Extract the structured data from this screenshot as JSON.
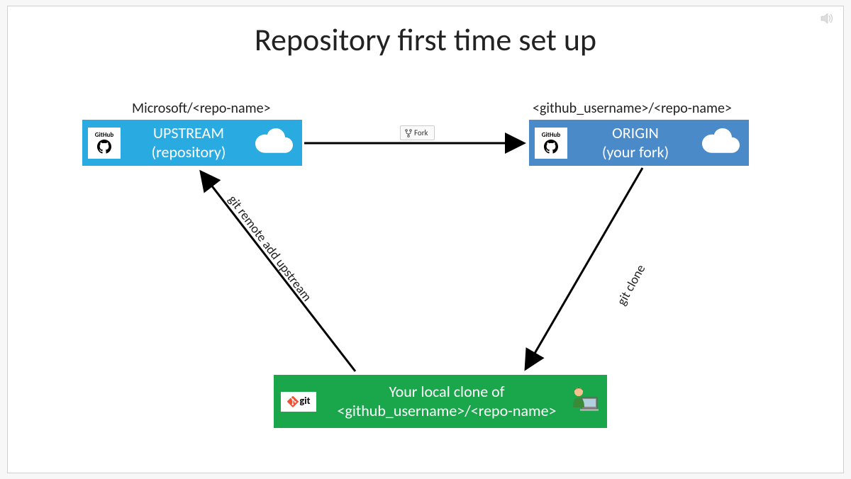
{
  "title": "Repository first time set up",
  "upstream": {
    "label": "Microsoft/<repo-name>",
    "line1": "UPSTREAM",
    "line2": "(repository)",
    "badge": "GitHub"
  },
  "origin": {
    "label": "<github_username>/<repo-name>",
    "line1": "ORIGIN",
    "line2": "(your fork)",
    "badge": "GitHub"
  },
  "local": {
    "line1": "Your local clone of",
    "line2": "<github_username>/<repo-name>",
    "badge": "git"
  },
  "fork_button": "Fork",
  "arrow_remote_add": "git remote add upstream",
  "arrow_clone": "git clone"
}
